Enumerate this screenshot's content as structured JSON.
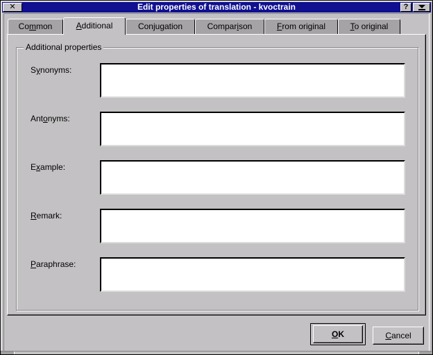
{
  "window": {
    "title": "Edit properties of translation - kvoctrain",
    "close_glyph": "✕",
    "help_glyph": "?"
  },
  "tabs": [
    {
      "label": "Common",
      "mnemonic_index": 2,
      "active": false
    },
    {
      "label": "Additional",
      "mnemonic_index": 0,
      "active": true
    },
    {
      "label": "Conjugation",
      "mnemonic_index": 3,
      "active": false
    },
    {
      "label": "Comparison",
      "mnemonic_index": 6,
      "active": false
    },
    {
      "label": "From original",
      "mnemonic_index": 0,
      "active": false
    },
    {
      "label": "To original",
      "mnemonic_index": 0,
      "active": false
    }
  ],
  "group": {
    "title": "Additional properties"
  },
  "fields": [
    {
      "label": "Synonyms:",
      "mnemonic_index": 1,
      "value": ""
    },
    {
      "label": "Antonyms:",
      "mnemonic_index": 3,
      "value": ""
    },
    {
      "label": "Example:",
      "mnemonic_index": 1,
      "value": ""
    },
    {
      "label": "Remark:",
      "mnemonic_index": 0,
      "value": ""
    },
    {
      "label": "Paraphrase:",
      "mnemonic_index": 0,
      "value": ""
    }
  ],
  "buttons": {
    "ok": {
      "label": "OK",
      "mnemonic_index": 0
    },
    "cancel": {
      "label": "Cancel",
      "mnemonic_index": 0
    }
  }
}
